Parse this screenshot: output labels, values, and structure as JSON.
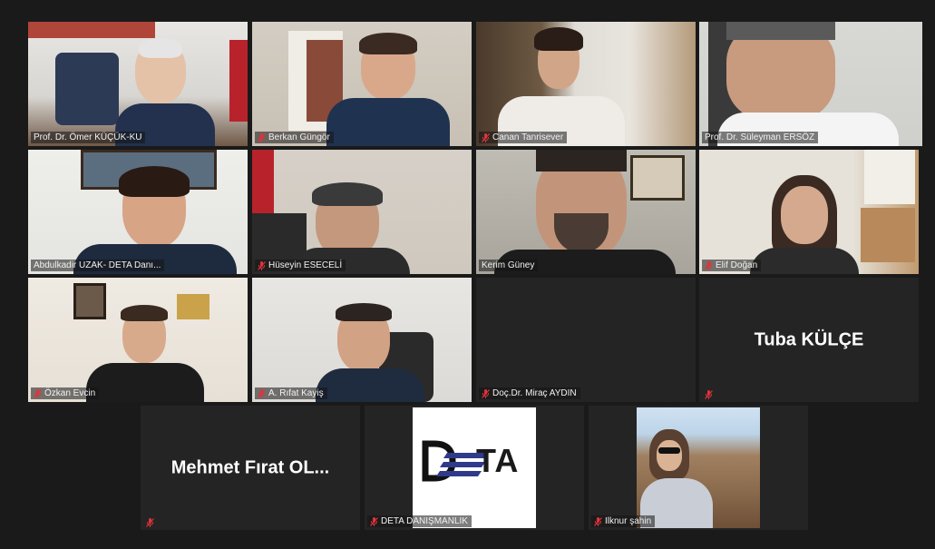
{
  "participants": [
    {
      "name": "Prof. Dr. Ömer KÜÇÜK-KU",
      "muted": false
    },
    {
      "name": "Berkan Güngör",
      "muted": true
    },
    {
      "name": "Canan Tanrisever",
      "muted": true
    },
    {
      "name": "Prof. Dr. Süleyman ERSÖZ",
      "muted": false,
      "speaking": true
    },
    {
      "name": "Abdulkadir UZAK- DETA Danı...",
      "muted": false
    },
    {
      "name": "Hüseyin ESECELİ",
      "muted": true
    },
    {
      "name": "Kerim Güney",
      "muted": false
    },
    {
      "name": "Elif Doğan",
      "muted": true
    },
    {
      "name": "Özkan Evcin",
      "muted": true
    },
    {
      "name": "A. Rıfat Kayiş",
      "muted": true
    },
    {
      "name": "Doç.Dr. Miraç AYDIN",
      "muted": true
    },
    {
      "name": "",
      "display_name": "Tuba KÜLÇE",
      "muted": true
    },
    {
      "name": "",
      "display_name": "Mehmet Fırat OL...",
      "muted": true
    },
    {
      "name": "DETA DANIŞMANLIK",
      "muted": true,
      "logo": "TA"
    },
    {
      "name": "Ilknur şahin",
      "muted": true
    }
  ],
  "colors": {
    "background": "#1a1a1a",
    "tile": "#242424",
    "active_border": "#d9d85a",
    "muted_icon": "#e0333a"
  },
  "icons": {
    "muted": "mic-muted-icon"
  }
}
